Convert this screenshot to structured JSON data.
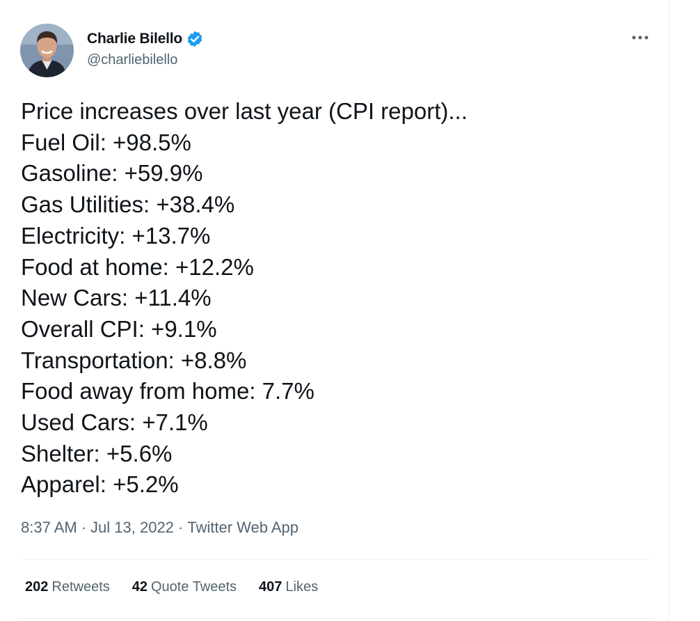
{
  "author": {
    "name": "Charlie Bilello",
    "handle": "@charliebilello",
    "verified_color": "#1d9bf0",
    "avatar": "avatar-photo"
  },
  "tweet": {
    "lines": [
      "Price increases over last year (CPI report)...",
      "Fuel Oil: +98.5%",
      "Gasoline: +59.9%",
      "Gas Utilities: +38.4%",
      "Electricity: +13.7%",
      "Food at home: +12.2%",
      "New Cars: +11.4%",
      "Overall CPI: +9.1%",
      "Transportation: +8.8%",
      "Food away from home: 7.7%",
      "Used Cars: +7.1%",
      "Shelter: +5.6%",
      "Apparel: +5.2%"
    ]
  },
  "meta": {
    "time": "8:37 AM",
    "date": "Jul 13, 2022",
    "source": "Twitter Web App",
    "separator": "·"
  },
  "stats": {
    "retweets_count": "202",
    "retweets_label": "Retweets",
    "quote_count": "42",
    "quote_label": "Quote Tweets",
    "likes_count": "407",
    "likes_label": "Likes"
  },
  "icons": {
    "more": "more-icon",
    "verified": "verified-badge-icon"
  },
  "colors": {
    "text_primary": "#0f1419",
    "text_secondary": "#536471",
    "border": "#eff3f4",
    "accent": "#1d9bf0"
  }
}
